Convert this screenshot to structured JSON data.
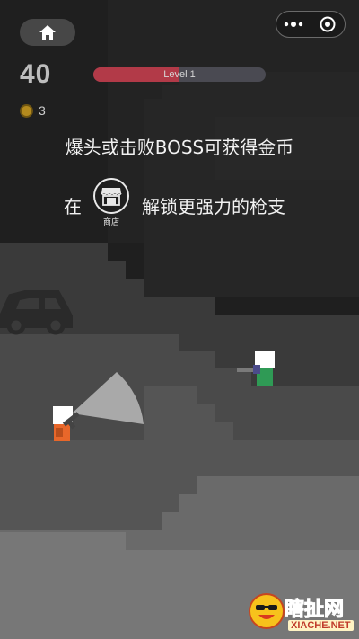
{
  "topbar": {
    "home_icon": "home-icon",
    "more_icon": "more-dots-icon",
    "close_icon": "target-circle-icon"
  },
  "hud": {
    "score": "40",
    "coins": "3",
    "level_label": "Level 1",
    "level_progress": 0.5
  },
  "tips": {
    "line1": "爆头或击败BOSS可获得金币",
    "line2_prefix": "在",
    "shop_label": "商店",
    "line2_suffix": "解锁更强力的枪支"
  },
  "watermark": {
    "title": "瞎扯网",
    "subtitle": "XIACHE.NET"
  },
  "colors": {
    "player": "#e8672a",
    "enemy": "#2f9a55",
    "level_bar": "#b23a48",
    "coin": "#b48a1e"
  }
}
